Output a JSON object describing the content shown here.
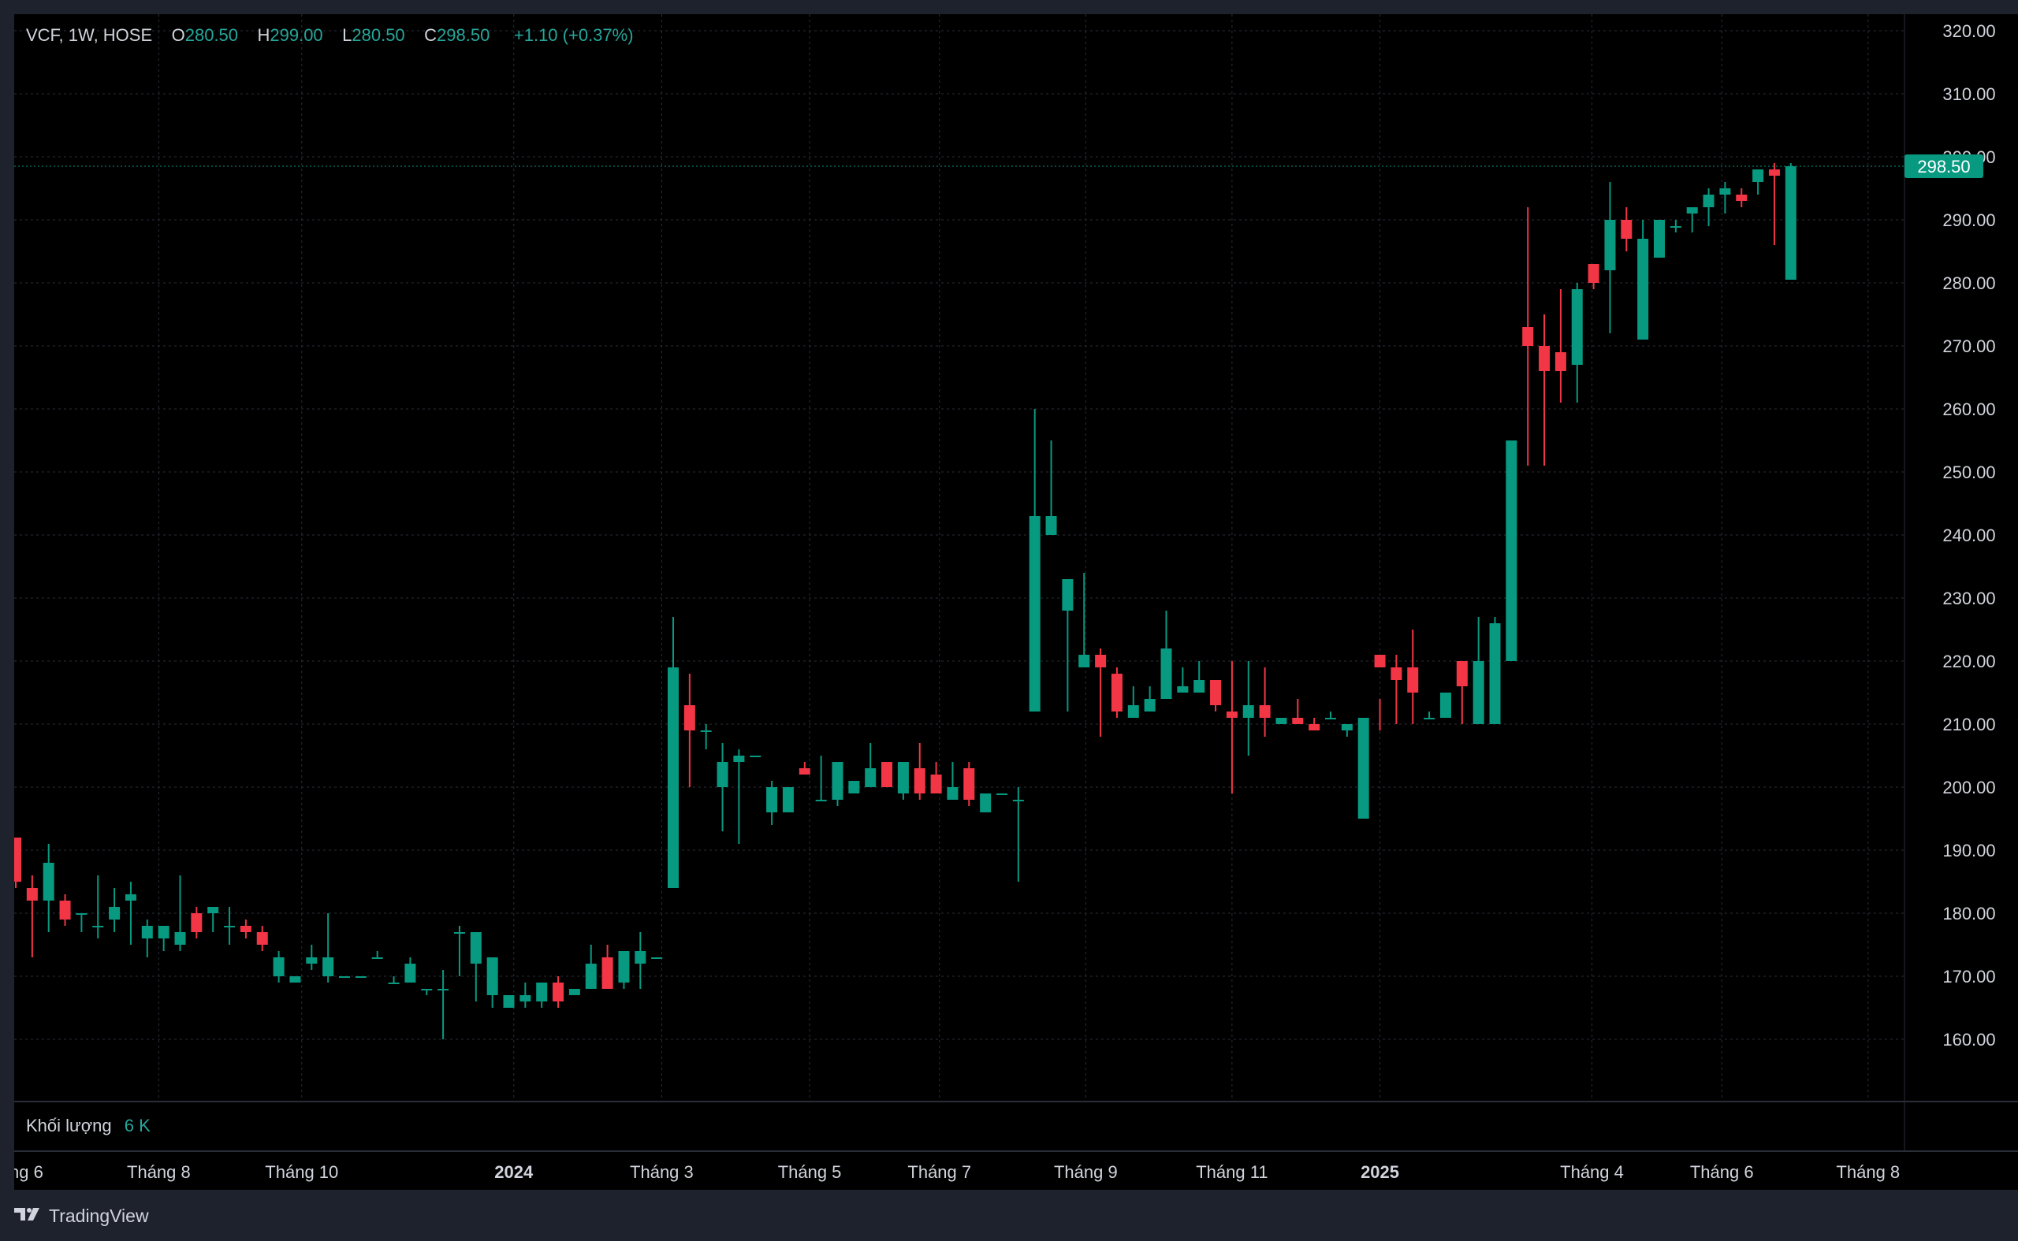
{
  "legend": {
    "symbol": "VCF, 1W, HOSE",
    "open_label": "O",
    "open": "280.50",
    "high_label": "H",
    "high": "299.00",
    "low_label": "L",
    "low": "280.50",
    "close_label": "C",
    "close": "298.50",
    "change": "+1.10 (+0.37%)"
  },
  "volume": {
    "label": "Khối lượng",
    "value": "6 K"
  },
  "brand": {
    "name": "TradingView"
  },
  "colors": {
    "up": "#089981",
    "down": "#f23645",
    "background": "#000000",
    "grid": "#2a2e39",
    "text": "#d1d4dc",
    "price_tag": "#089981"
  },
  "chart_data": {
    "type": "candlestick",
    "ylim": [
      152,
      322
    ],
    "price_ticks": [
      "160.00",
      "170.00",
      "180.00",
      "190.00",
      "200.00",
      "210.00",
      "220.00",
      "230.00",
      "240.00",
      "250.00",
      "260.00",
      "270.00",
      "280.00",
      "290.00",
      "300.00",
      "310.00",
      "320.00"
    ],
    "current_price": "298.50",
    "time_labels": [
      {
        "label": "ng 6",
        "bold": false,
        "index": -1
      },
      {
        "label": "Tháng 8",
        "bold": false,
        "index": 8.7
      },
      {
        "label": "Tháng 10",
        "bold": false,
        "index": 17.4
      },
      {
        "label": "2024",
        "bold": true,
        "index": 30.3
      },
      {
        "label": "Tháng 3",
        "bold": false,
        "index": 39.3
      },
      {
        "label": "Tháng 5",
        "bold": false,
        "index": 48.3
      },
      {
        "label": "Tháng 7",
        "bold": false,
        "index": 56.2
      },
      {
        "label": "Tháng 9",
        "bold": false,
        "index": 65.1
      },
      {
        "label": "Tháng 11",
        "bold": false,
        "index": 74.0
      },
      {
        "label": "2025",
        "bold": true,
        "index": 83.0
      },
      {
        "label": "Tháng 4",
        "bold": false,
        "index": 95.9
      },
      {
        "label": "Tháng 6",
        "bold": false,
        "index": 103.8
      },
      {
        "label": "Tháng 8",
        "bold": false,
        "index": 112.7
      }
    ],
    "candles": [
      [
        192,
        192,
        184,
        185
      ],
      [
        184,
        186,
        173,
        182
      ],
      [
        182,
        191,
        177,
        188
      ],
      [
        182,
        183,
        178,
        179
      ],
      [
        180,
        180,
        177,
        180
      ],
      [
        178,
        186,
        176,
        178
      ],
      [
        179,
        184,
        177,
        181
      ],
      [
        182,
        185,
        175,
        183
      ],
      [
        176,
        179,
        173,
        178
      ],
      [
        176,
        177,
        174,
        178
      ],
      [
        175,
        186,
        174,
        177
      ],
      [
        180,
        181,
        176,
        177
      ],
      [
        180,
        181,
        177,
        181
      ],
      [
        178,
        181,
        175,
        178
      ],
      [
        178,
        179,
        176,
        177
      ],
      [
        177,
        178,
        174,
        175
      ],
      [
        170,
        174,
        169,
        173
      ],
      [
        169,
        170,
        169,
        170
      ],
      [
        172,
        175,
        171,
        173
      ],
      [
        170,
        180,
        169,
        173
      ],
      [
        170,
        170,
        170,
        170
      ],
      [
        170,
        170,
        170,
        170
      ],
      [
        173,
        174,
        173,
        173
      ],
      [
        169,
        170,
        169,
        169
      ],
      [
        169,
        173,
        169,
        172
      ],
      [
        168,
        168,
        167,
        168
      ],
      [
        168,
        171,
        160,
        168
      ],
      [
        177,
        178,
        170,
        177
      ],
      [
        172,
        177,
        166,
        177
      ],
      [
        167,
        172,
        165,
        173
      ],
      [
        165,
        167,
        165,
        167
      ],
      [
        166,
        169,
        165,
        167
      ],
      [
        166,
        168,
        165,
        169
      ],
      [
        169,
        170,
        165,
        166
      ],
      [
        167,
        168,
        167,
        168
      ],
      [
        168,
        175,
        168,
        172
      ],
      [
        173,
        175,
        168,
        168
      ],
      [
        169,
        174,
        168,
        174
      ],
      [
        172,
        177,
        168,
        174
      ],
      [
        173,
        173,
        173,
        173
      ],
      [
        184,
        227,
        184,
        219
      ],
      [
        213,
        218,
        200,
        209
      ],
      [
        209,
        210,
        206,
        209
      ],
      [
        200,
        207,
        193,
        204
      ],
      [
        204,
        206,
        191,
        205
      ],
      [
        205,
        205,
        205,
        205
      ],
      [
        196,
        201,
        194,
        200
      ],
      [
        196,
        200,
        196,
        200
      ],
      [
        203,
        204,
        202,
        202
      ],
      [
        198,
        205,
        198,
        198
      ],
      [
        198,
        204,
        197,
        204
      ],
      [
        199,
        200,
        199,
        201
      ],
      [
        200,
        207,
        200,
        203
      ],
      [
        204,
        204,
        200,
        200
      ],
      [
        199,
        204,
        198,
        204
      ],
      [
        203,
        207,
        198,
        199
      ],
      [
        202,
        204,
        200,
        199
      ],
      [
        198,
        204,
        198,
        200
      ],
      [
        203,
        204,
        197,
        198
      ],
      [
        196,
        197,
        196,
        199
      ],
      [
        199,
        199,
        199,
        199
      ],
      [
        198,
        200,
        185,
        198
      ],
      [
        212,
        260,
        212,
        243
      ],
      [
        240,
        255,
        240,
        243
      ],
      [
        228,
        233,
        212,
        233
      ],
      [
        219,
        234,
        219,
        221
      ],
      [
        221,
        222,
        208,
        219
      ],
      [
        218,
        219,
        211,
        212
      ],
      [
        211,
        216,
        211,
        213
      ],
      [
        212,
        216,
        212,
        214
      ],
      [
        214,
        228,
        214,
        222
      ],
      [
        215,
        219,
        215,
        216
      ],
      [
        215,
        220,
        215,
        217
      ],
      [
        217,
        217,
        212,
        213
      ],
      [
        212,
        220,
        199,
        211
      ],
      [
        211,
        220,
        205,
        213
      ],
      [
        213,
        219,
        208,
        211
      ],
      [
        210,
        211,
        210,
        211
      ],
      [
        211,
        214,
        210,
        210
      ],
      [
        210,
        211,
        210,
        209
      ],
      [
        211,
        212,
        211,
        211
      ],
      [
        209,
        209,
        208,
        210
      ],
      [
        195,
        210,
        195,
        211
      ],
      [
        221,
        214,
        209,
        219
      ],
      [
        219,
        221,
        210,
        217
      ],
      [
        219,
        225,
        210,
        215
      ],
      [
        211,
        212,
        211,
        211
      ],
      [
        211,
        212,
        211,
        215
      ],
      [
        220,
        220,
        210,
        216
      ],
      [
        210,
        227,
        210,
        220
      ],
      [
        210,
        227,
        210,
        226
      ],
      [
        220,
        255,
        220,
        255
      ],
      [
        273,
        292,
        251,
        270
      ],
      [
        270,
        275,
        251,
        266
      ],
      [
        269,
        279,
        261,
        266
      ],
      [
        267,
        280,
        261,
        279
      ],
      [
        283,
        282,
        279,
        280
      ],
      [
        282,
        296,
        272,
        290
      ],
      [
        290,
        292,
        285,
        287
      ],
      [
        271,
        290,
        271,
        287
      ],
      [
        284,
        290,
        284,
        290
      ],
      [
        289,
        290,
        288,
        289
      ],
      [
        291,
        292,
        288,
        292
      ],
      [
        292,
        295,
        289,
        294
      ],
      [
        294,
        296,
        291,
        295
      ],
      [
        294,
        295,
        292,
        293
      ],
      [
        296,
        297,
        294,
        298
      ],
      [
        298,
        299,
        286,
        297
      ],
      [
        280.5,
        299,
        280.5,
        298.5
      ]
    ]
  }
}
